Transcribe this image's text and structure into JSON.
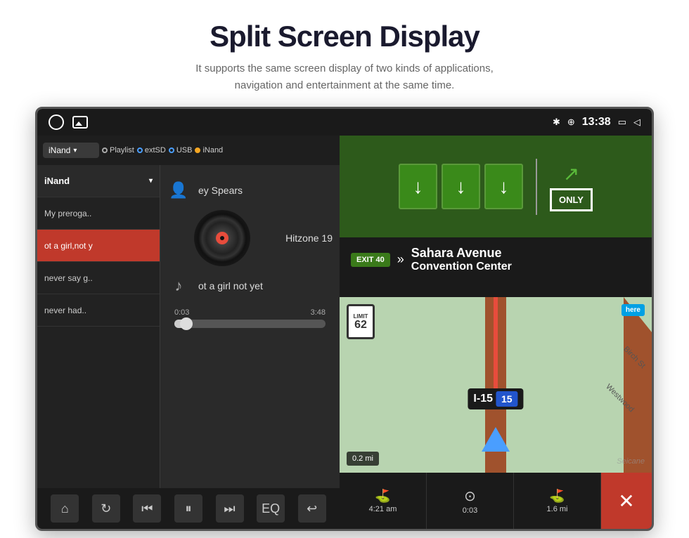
{
  "header": {
    "title": "Split Screen Display",
    "subtitle": "It supports the same screen display of two kinds of applications,\nnavigation and entertainment at the same time."
  },
  "status_bar": {
    "time": "13:38",
    "bluetooth": "✱",
    "location": "⊕"
  },
  "music": {
    "source_label": "iNand",
    "sources": [
      {
        "label": "Playlist",
        "type": "radio"
      },
      {
        "label": "extSD",
        "type": "radio"
      },
      {
        "label": "USB",
        "type": "radio"
      },
      {
        "label": "iNand",
        "type": "radio-active"
      }
    ],
    "playlist": [
      {
        "title": "My preroga..",
        "highlight": false
      },
      {
        "title": "ot a girl,not y",
        "highlight": true
      },
      {
        "title": "never say g..",
        "highlight": false
      },
      {
        "title": "never had..",
        "highlight": false
      }
    ],
    "track_artist": "ey Spears",
    "track_album": "Hitzone 19",
    "track_title": "ot a girl not yet",
    "time_current": "0:03",
    "time_total": "3:48",
    "progress_percent": 8
  },
  "navigation": {
    "exit_number": "EXIT 40",
    "exit_destination": "Sahara Avenue",
    "exit_sub": "Convention Center",
    "speed": "62",
    "highway": "I-15",
    "highway_num": "15",
    "distance_turn": "0.2 mi",
    "eta": "4:21 am",
    "time_driving": "0:03",
    "distance_remaining": "1.6 mi",
    "only_label": "ONLY",
    "speed_limit_label": "LIMIT",
    "here_label": "here"
  },
  "controls": {
    "home": "⌂",
    "repeat": "↻",
    "prev": "⏮",
    "pause": "⏸",
    "next": "⏭",
    "eq": "EQ",
    "back": "↩"
  }
}
